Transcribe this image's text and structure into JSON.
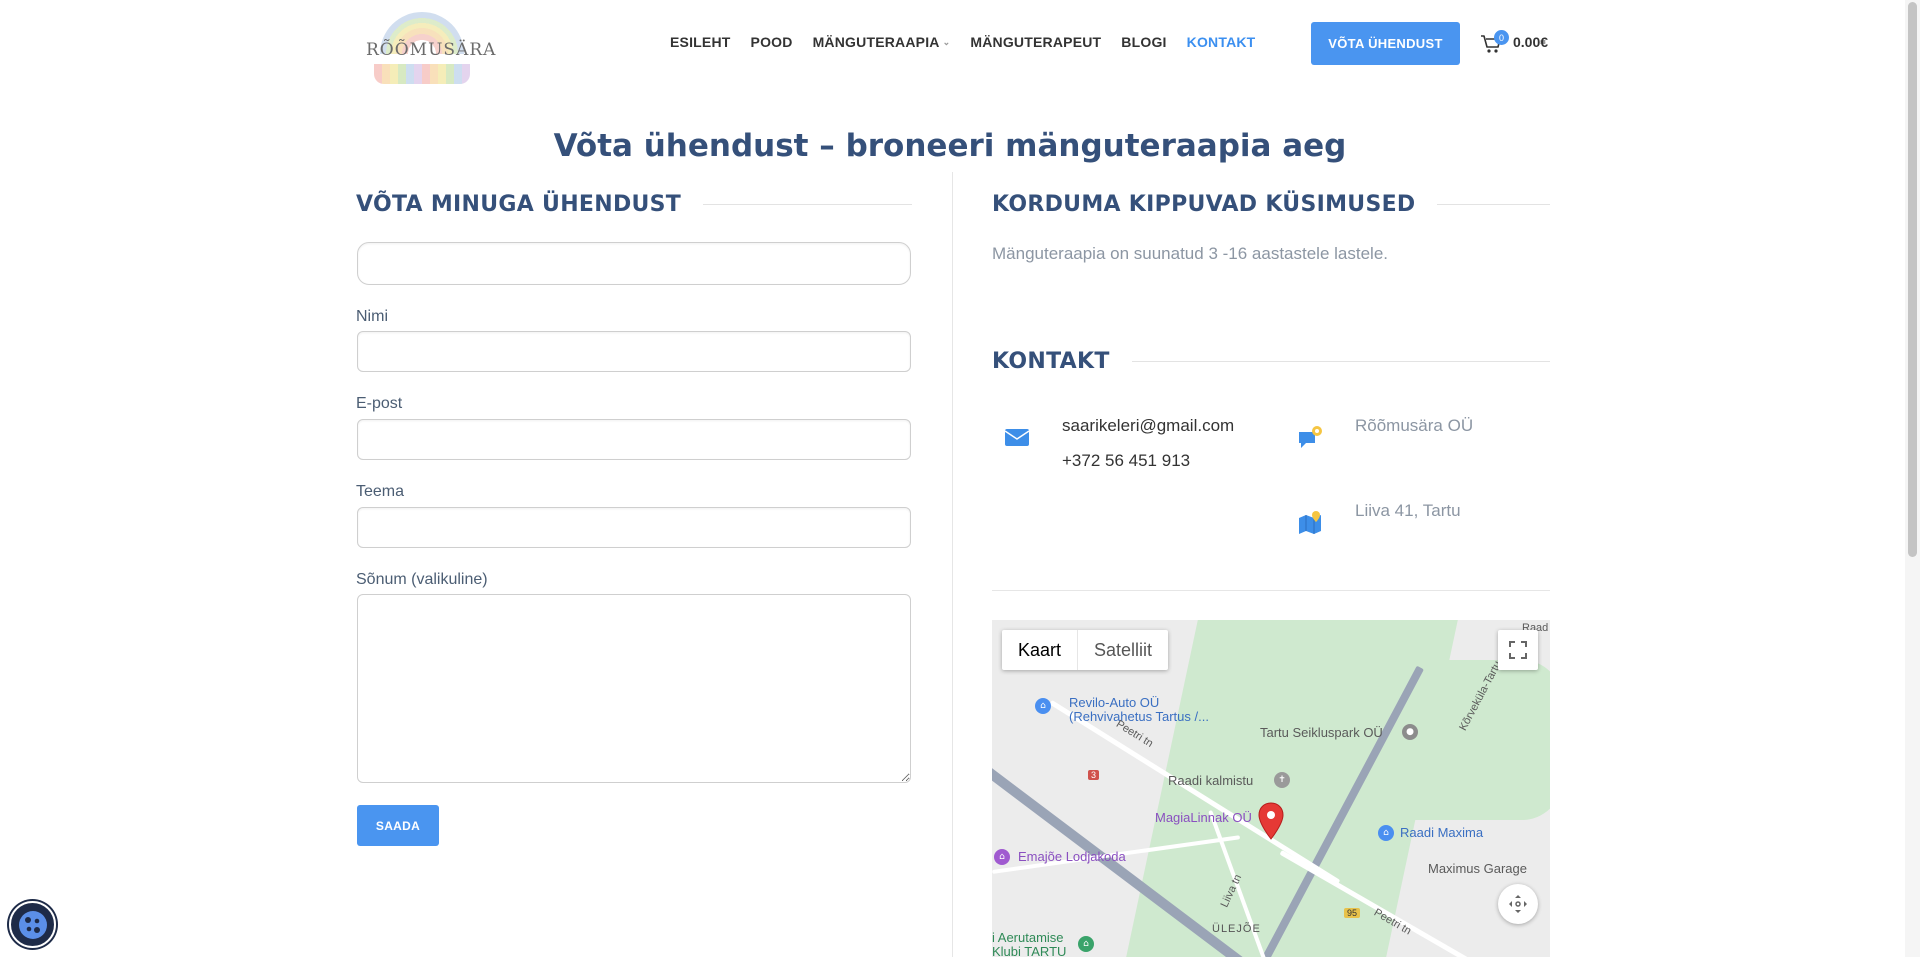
{
  "header": {
    "logo_text": "RÕÕMUSÄRA",
    "nav": [
      {
        "label": "ESILEHT"
      },
      {
        "label": "POOD"
      },
      {
        "label": "MÄNGUTERAAPIA"
      },
      {
        "label": "MÄNGUTERAPEUT"
      },
      {
        "label": "BLOGI"
      },
      {
        "label": "KONTAKT"
      }
    ],
    "cta_label": "VÕTA ÜHENDUST",
    "cart_count": "0",
    "cart_total": "0.00€"
  },
  "page": {
    "title": "Võta ühendust – broneeri mänguteraapia aeg"
  },
  "form": {
    "heading": "VÕTA MINUGA ÜHENDUST",
    "name_label": "Nimi",
    "email_label": "E-post",
    "subject_label": "Teema",
    "message_label": "Sõnum (valikuline)",
    "submit_label": "SAADA"
  },
  "faq": {
    "heading": "KORDUMA KIPPUVAD KÜSIMUSED",
    "text": "Mänguteraapia on suunatud 3 -16 aastastele lastele."
  },
  "contact": {
    "heading": "KONTAKT",
    "email": "saarikeleri@gmail.com",
    "phone": "+372 56 451 913",
    "company": "Rõõmusära OÜ",
    "address": "Liiva 41, Tartu"
  },
  "map": {
    "type_map": "Kaart",
    "type_satellite": "Satelliit",
    "labels": {
      "revilo1": "Revilo-Auto OÜ",
      "revilo2": "(Rehvivahetus Tartus /...",
      "peetri1": "Peetri tn",
      "peetri2": "Peetri tn",
      "seikluspark": "Tartu Seikluspark OÜ",
      "korvekula": "Kõrveküla-Tartu",
      "kalmistu": "Raadi kalmistu",
      "magialinnak": "MagiaLinnak OÜ",
      "maxima": "Raadi Maxima",
      "garage": "Maximus Garage",
      "lodjakoda": "Emajõe Lodjakoda",
      "liiva": "Liiva tn",
      "uleoje": "ÜLEJÕE",
      "aerutamise1": "i Aerutamise",
      "aerutamise2": "Klubi TARTU",
      "road3": "3",
      "road95": "95",
      "raad": "Raad"
    }
  },
  "colors": {
    "accent": "#4a95f0",
    "heading": "#35507a",
    "muted": "#8c96a3"
  },
  "icons": [
    "cart-icon",
    "mail-icon",
    "chat-icon",
    "map-icon",
    "fullscreen-icon",
    "pan-icon",
    "cookie-icon"
  ]
}
